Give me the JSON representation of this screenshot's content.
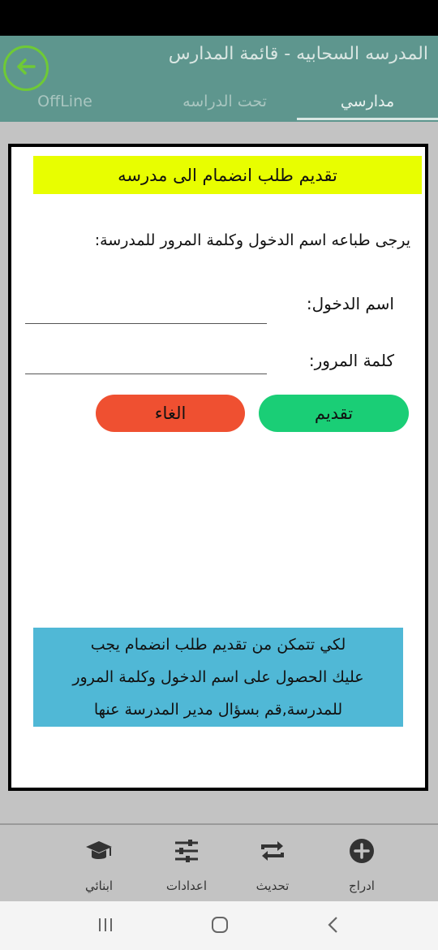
{
  "app_bar": {
    "title": "المدرسه السحابيه - قائمة المدارس",
    "back_icon": "arrow-left-circle-icon",
    "tabs": [
      {
        "label": "مدارسي",
        "active": true
      },
      {
        "label": "تحت الدراسه",
        "active": false
      },
      {
        "label": "OffLine",
        "active": false
      }
    ]
  },
  "form": {
    "heading": "تقديم طلب انضمام الى مدرسه",
    "instruction": "يرجى طباعه اسم الدخول وكلمة المرور للمدرسة:",
    "username_label": "اسم الدخول:",
    "username_value": "",
    "password_label": "كلمة المرور:",
    "password_value": "",
    "submit_label": "تقديم",
    "cancel_label": "الغاء"
  },
  "info": {
    "line1": "لكي تتمكن من تقديم طلب انضمام يجب",
    "line2": "عليك الحصول على اسم الدخول وكلمة المرور",
    "line3": "للمدرسة,قم بسؤال مدير المدرسة عنها"
  },
  "bottom_nav": {
    "items": [
      {
        "label": "ادراج",
        "icon": "plus-circle-icon"
      },
      {
        "label": "تحديث",
        "icon": "refresh-icon"
      },
      {
        "label": "اعدادات",
        "icon": "sliders-icon"
      },
      {
        "label": "ابنائي",
        "icon": "graduation-cap-icon"
      }
    ]
  },
  "colors": {
    "app_bar": "#5e968e",
    "heading_bg": "#e8fe00",
    "submit": "#1ace76",
    "cancel": "#ef5031",
    "info_bg": "#50b8d6"
  }
}
